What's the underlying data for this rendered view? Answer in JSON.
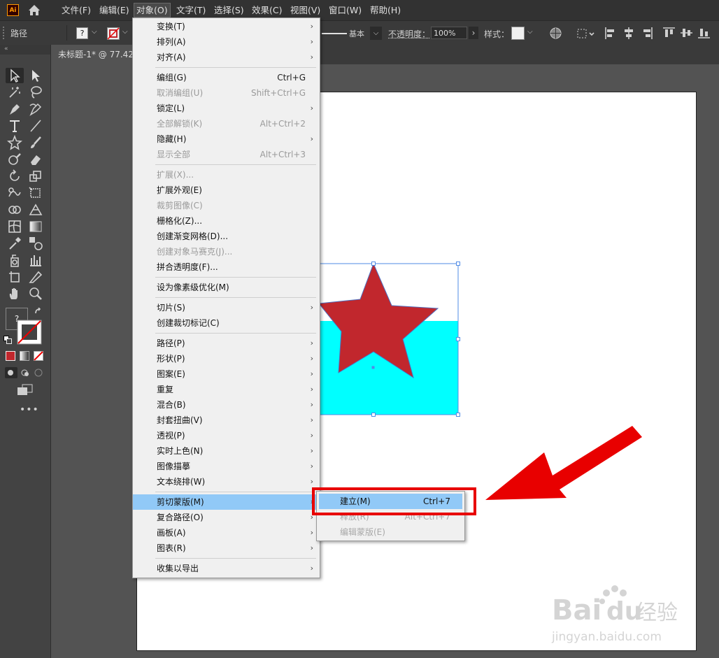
{
  "menubar": {
    "app_logo": "Ai",
    "items": [
      {
        "label": "文件(F)"
      },
      {
        "label": "编辑(E)"
      },
      {
        "label": "对象(O)"
      },
      {
        "label": "文字(T)"
      },
      {
        "label": "选择(S)"
      },
      {
        "label": "效果(C)"
      },
      {
        "label": "视图(V)"
      },
      {
        "label": "窗口(W)"
      },
      {
        "label": "帮助(H)"
      }
    ]
  },
  "controlbar": {
    "selection_label": "路径",
    "stroke_profile": "基本",
    "opacity_label": "不透明度：",
    "opacity_value": "100%",
    "style_label": "样式：",
    "fill_question": "?"
  },
  "document": {
    "tab_title": "未标题-1* @ 77.42"
  },
  "object_menu": {
    "items": [
      {
        "label": "变换(T)",
        "shortcut": "",
        "arrow": "›"
      },
      {
        "label": "排列(A)",
        "shortcut": "",
        "arrow": "›"
      },
      {
        "label": "对齐(A)",
        "shortcut": "",
        "arrow": "›"
      },
      {
        "label": "编组(G)",
        "shortcut": "Ctrl+G",
        "arrow": ""
      },
      {
        "label": "取消编组(U)",
        "shortcut": "Shift+Ctrl+G",
        "arrow": ""
      },
      {
        "label": "锁定(L)",
        "shortcut": "",
        "arrow": "›"
      },
      {
        "label": "全部解锁(K)",
        "shortcut": "Alt+Ctrl+2",
        "arrow": ""
      },
      {
        "label": "隐藏(H)",
        "shortcut": "",
        "arrow": "›"
      },
      {
        "label": "显示全部",
        "shortcut": "Alt+Ctrl+3",
        "arrow": ""
      },
      {
        "label": "扩展(X)...",
        "shortcut": "",
        "arrow": ""
      },
      {
        "label": "扩展外观(E)",
        "shortcut": "",
        "arrow": ""
      },
      {
        "label": "裁剪图像(C)",
        "shortcut": "",
        "arrow": ""
      },
      {
        "label": "栅格化(Z)...",
        "shortcut": "",
        "arrow": ""
      },
      {
        "label": "创建渐变网格(D)...",
        "shortcut": "",
        "arrow": ""
      },
      {
        "label": "创建对象马赛克(J)...",
        "shortcut": "",
        "arrow": ""
      },
      {
        "label": "拼合透明度(F)...",
        "shortcut": "",
        "arrow": ""
      },
      {
        "label": "设为像素级优化(M)",
        "shortcut": "",
        "arrow": ""
      },
      {
        "label": "切片(S)",
        "shortcut": "",
        "arrow": "›"
      },
      {
        "label": "创建裁切标记(C)",
        "shortcut": "",
        "arrow": ""
      },
      {
        "label": "路径(P)",
        "shortcut": "",
        "arrow": "›"
      },
      {
        "label": "形状(P)",
        "shortcut": "",
        "arrow": "›"
      },
      {
        "label": "图案(E)",
        "shortcut": "",
        "arrow": "›"
      },
      {
        "label": "重复",
        "shortcut": "",
        "arrow": "›"
      },
      {
        "label": "混合(B)",
        "shortcut": "",
        "arrow": "›"
      },
      {
        "label": "封套扭曲(V)",
        "shortcut": "",
        "arrow": "›"
      },
      {
        "label": "透视(P)",
        "shortcut": "",
        "arrow": "›"
      },
      {
        "label": "实时上色(N)",
        "shortcut": "",
        "arrow": "›"
      },
      {
        "label": "图像描摹",
        "shortcut": "",
        "arrow": "›"
      },
      {
        "label": "文本绕排(W)",
        "shortcut": "",
        "arrow": "›"
      },
      {
        "label": "剪切蒙版(M)",
        "shortcut": "",
        "arrow": "›"
      },
      {
        "label": "复合路径(O)",
        "shortcut": "",
        "arrow": "›"
      },
      {
        "label": "画板(A)",
        "shortcut": "",
        "arrow": "›"
      },
      {
        "label": "图表(R)",
        "shortcut": "",
        "arrow": "›"
      },
      {
        "label": "收集以导出",
        "shortcut": "",
        "arrow": "›"
      }
    ]
  },
  "clipping_submenu": {
    "items": [
      {
        "label": "建立(M)",
        "shortcut": "Ctrl+7"
      },
      {
        "label": "释放(R)",
        "shortcut": "Alt+Ctrl+7"
      },
      {
        "label": "编辑蒙版(E)",
        "shortcut": ""
      }
    ]
  },
  "colors": {
    "star_fill": "#c1272d",
    "rect_fill": "#00ffff",
    "menu_highlight": "#91c9f7",
    "annotation_red": "#e80000"
  },
  "watermark": {
    "brand": "Bai",
    "brand_suffix": "du",
    "cn": "经验",
    "url": "jingyan.baidu.com"
  }
}
